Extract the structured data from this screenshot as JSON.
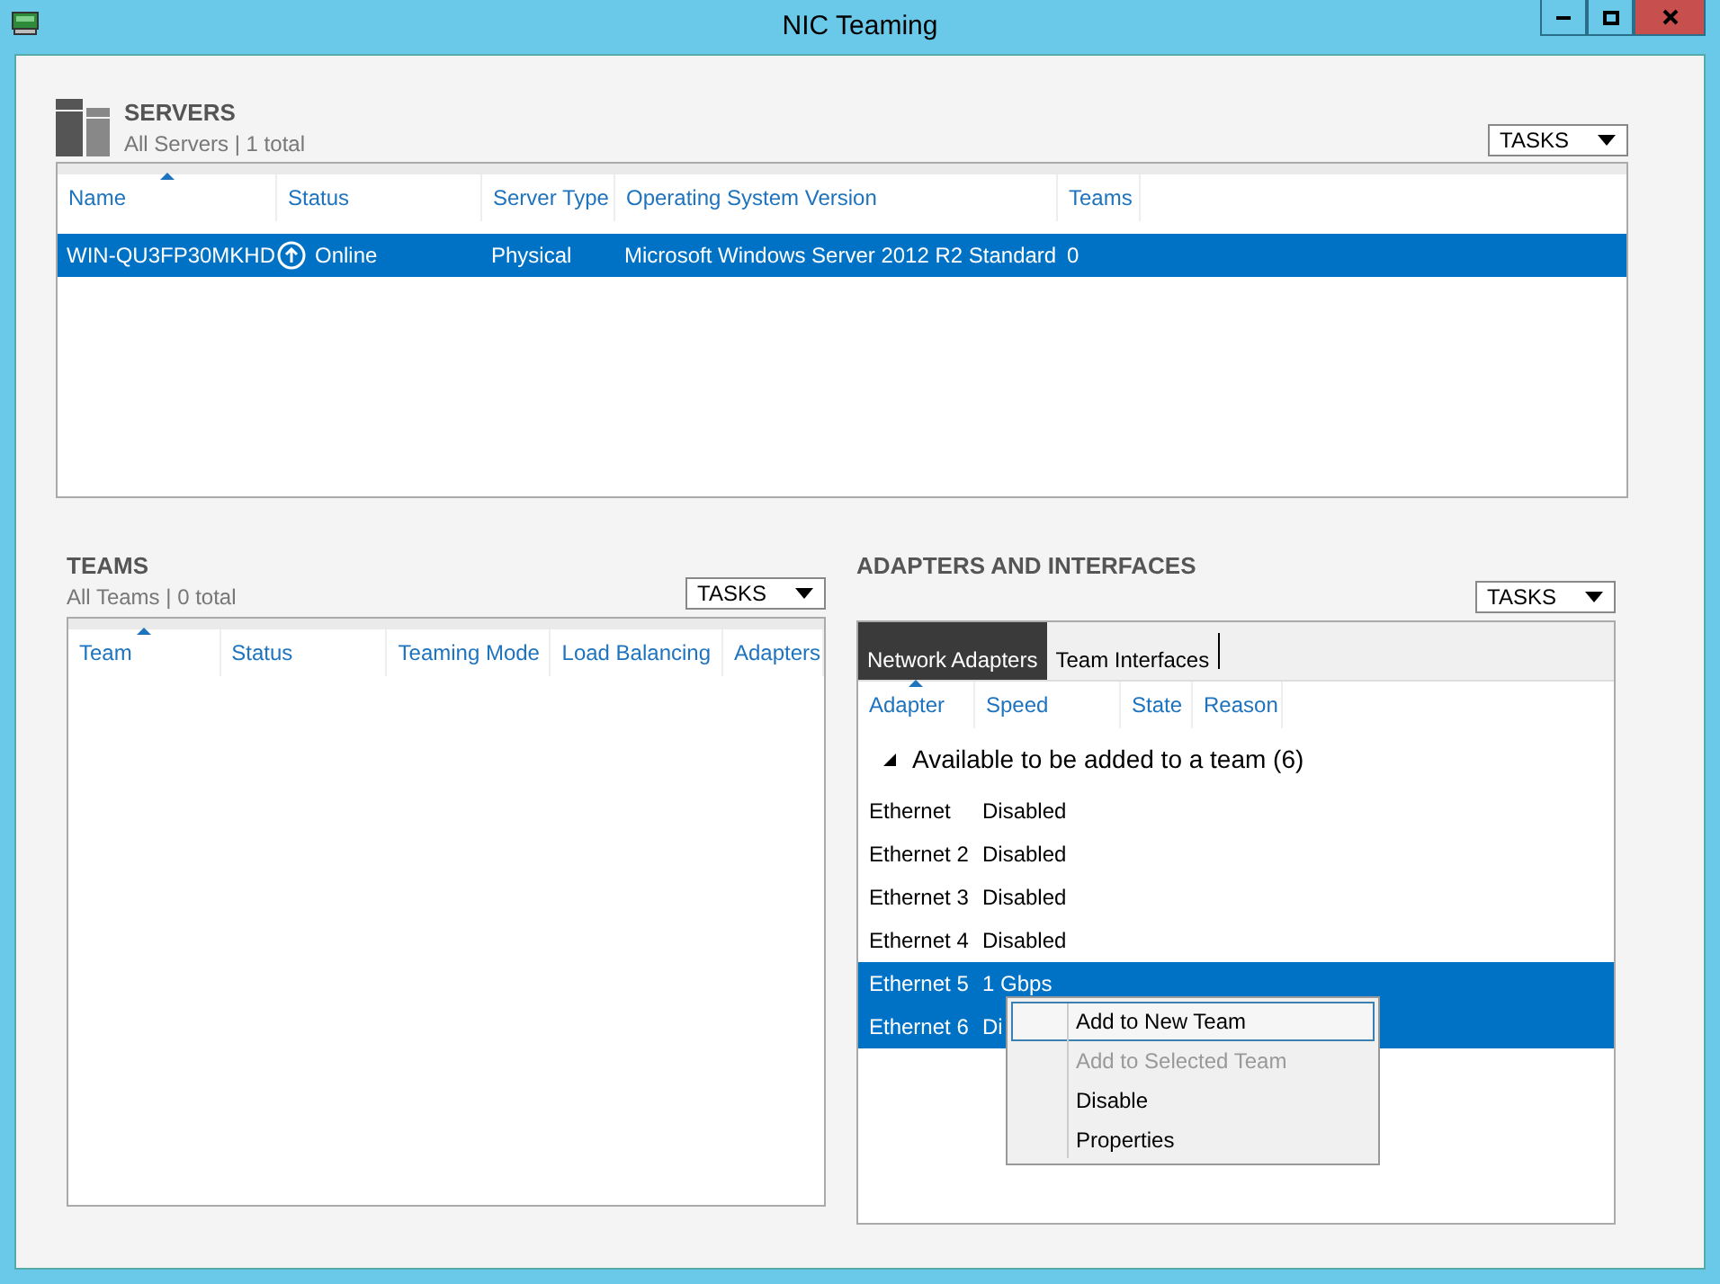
{
  "window": {
    "title": "NIC Teaming"
  },
  "servers": {
    "title": "SERVERS",
    "subtitle": "All Servers | 1 total",
    "tasks": "TASKS",
    "columns": [
      {
        "label": "Name",
        "sorted": true
      },
      {
        "label": "Status",
        "sorted": false
      },
      {
        "label": "Server Type",
        "sorted": false
      },
      {
        "label": "Operating System Version",
        "sorted": false
      },
      {
        "label": "Teams",
        "sorted": false
      }
    ],
    "rows": [
      {
        "name": "WIN-QU3FP30MKHD",
        "status": "Online",
        "server_type": "Physical",
        "os_version": "Microsoft Windows Server 2012 R2 Standard",
        "teams": "0",
        "selected": true
      }
    ]
  },
  "teams": {
    "title": "TEAMS",
    "subtitle": "All Teams | 0 total",
    "tasks": "TASKS",
    "columns": [
      {
        "label": "Team",
        "sorted": true
      },
      {
        "label": "Status",
        "sorted": false
      },
      {
        "label": "Teaming Mode",
        "sorted": false
      },
      {
        "label": "Load Balancing",
        "sorted": false
      },
      {
        "label": "Adapters",
        "sorted": false
      }
    ]
  },
  "adapters": {
    "title": "ADAPTERS AND INTERFACES",
    "tasks": "TASKS",
    "tabs": [
      {
        "label": "Network Adapters",
        "selected": true
      },
      {
        "label": "Team Interfaces",
        "selected": false
      }
    ],
    "columns": [
      {
        "label": "Adapter",
        "sorted": true
      },
      {
        "label": "Speed",
        "sorted": false
      },
      {
        "label": "State",
        "sorted": false
      },
      {
        "label": "Reason",
        "sorted": false
      }
    ],
    "group": {
      "label": "Available to be added to a team (6)",
      "expanded": true,
      "rows": [
        {
          "adapter": "Ethernet",
          "speed": "Disabled",
          "selected": false
        },
        {
          "adapter": "Ethernet 2",
          "speed": "Disabled",
          "selected": false
        },
        {
          "adapter": "Ethernet 3",
          "speed": "Disabled",
          "selected": false
        },
        {
          "adapter": "Ethernet 4",
          "speed": "Disabled",
          "selected": false
        },
        {
          "adapter": "Ethernet 5",
          "speed": "1 Gbps",
          "selected": true
        },
        {
          "adapter": "Ethernet 6",
          "speed": "Di",
          "selected": true
        }
      ]
    }
  },
  "context_menu": {
    "items": [
      {
        "label": "Add to New Team",
        "selected": true,
        "disabled": false
      },
      {
        "label": "Add to Selected Team",
        "selected": false,
        "disabled": true
      },
      {
        "label": "Disable",
        "selected": false,
        "disabled": false
      },
      {
        "label": "Properties",
        "selected": false,
        "disabled": false
      }
    ]
  }
}
